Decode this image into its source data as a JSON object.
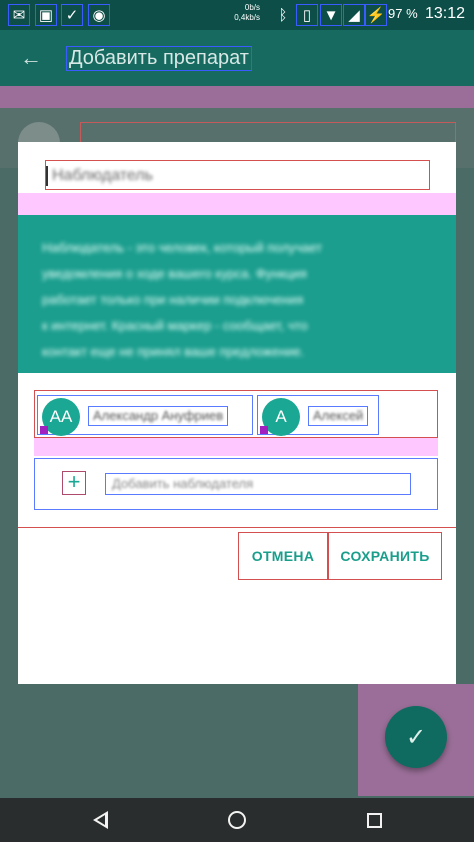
{
  "status_bar": {
    "icons": [
      "mail-icon",
      "image-icon",
      "check-icon",
      "android-icon",
      "bluetooth-icon",
      "vibrate-icon",
      "wifi-icon",
      "signal-icon",
      "battery-charging-icon"
    ],
    "net_up": "0b/s",
    "net_down": "0,4kb/s",
    "battery": "97 %",
    "time": "13:12"
  },
  "app_bar": {
    "title": "Добавить препарат"
  },
  "dialog": {
    "name_placeholder": "Наблюдатель",
    "info_text": [
      "Наблюдатель - это человек, который получает",
      "уведомления о ходе вашего курса. Функция",
      "работает только при наличии подключения",
      "к интернет. Красный маркер - сообщает, что",
      "контакт еще не принял ваше предложение."
    ],
    "observers": [
      {
        "initials": "AA",
        "name": "Александр Ануфриев"
      },
      {
        "initials": "A",
        "name": "Алексей"
      }
    ],
    "add_observer_label": "Добавить наблюдателя",
    "cancel_label": "ОТМЕНА",
    "save_label": "СОХРАНИТЬ"
  },
  "colors": {
    "accent": "#1a9e8c",
    "primary_dark": "#0d4f48"
  }
}
